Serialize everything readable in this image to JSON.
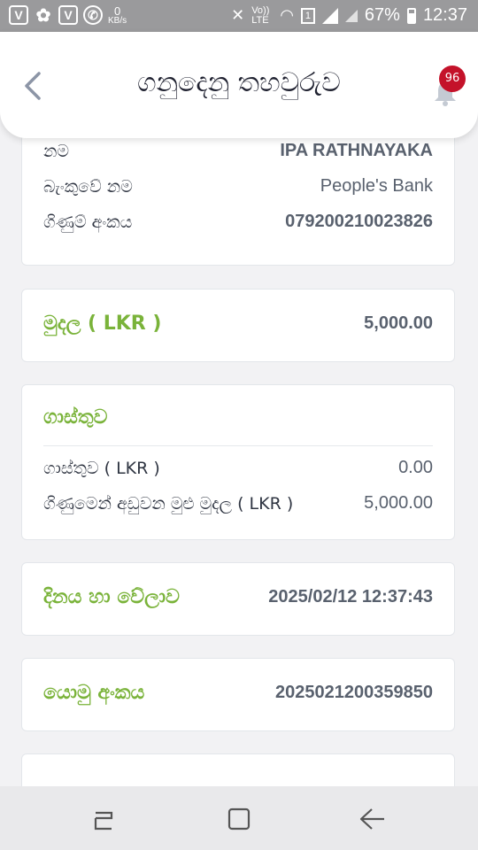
{
  "status_bar": {
    "left_icons": [
      "v-app-icon",
      "grid-app-icon",
      "v-app-icon",
      "whatsapp-icon"
    ],
    "left_icon_glyphs": [
      "V",
      "✿",
      "V",
      "✆"
    ],
    "net_speed_value": "0",
    "net_speed_unit": "KB/s",
    "volte_label": "Vo)) LTE",
    "sim_label": "1",
    "battery_percent": "67%",
    "time": "12:37"
  },
  "header": {
    "back_glyph": "<",
    "title": "ගනුදෙනු තහවුරුව",
    "notification_count": "96"
  },
  "account_card": {
    "name_label": "නම",
    "name_value": "IPA RATHNAYAKA",
    "bank_label": "බැංකුවේ නම",
    "bank_value": "People's Bank",
    "account_label": "ගිණුම් අංකය",
    "account_value": "079200210023826"
  },
  "amount_card": {
    "label": "මුදල ( LKR )",
    "value": "5,000.00"
  },
  "fee_card": {
    "heading": "ගාස්තුව",
    "fee_label": "ගාස්තුව ( LKR )",
    "fee_value": "0.00",
    "total_label": "ගිණුමෙන් අඩුවන මුළු මුදල ( LKR )",
    "total_value": "5,000.00"
  },
  "datetime_card": {
    "label": "දිනය හා වේලාව",
    "value": "2025/02/12 12:37:43"
  },
  "reference_card": {
    "label": "යොමු අංකය",
    "value": "2025021200359850"
  },
  "colors": {
    "accent_green": "#7ab33a",
    "badge_red": "#c4122a"
  }
}
